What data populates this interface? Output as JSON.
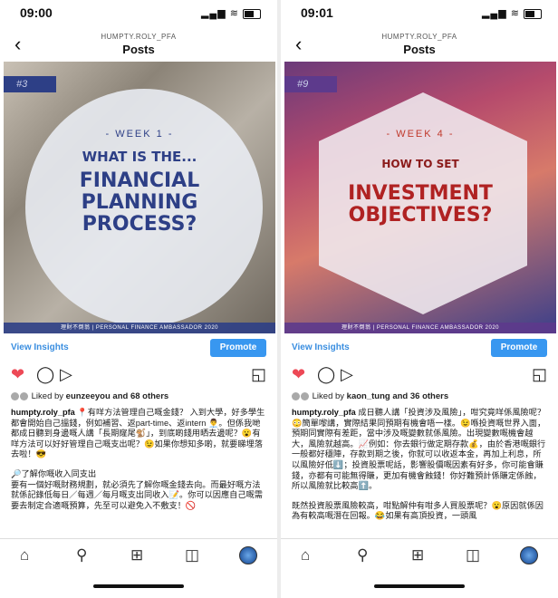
{
  "phones": [
    {
      "time": "09:00",
      "username": "HUMPTY.ROLY_PFA",
      "title": "Posts",
      "post": {
        "tag": "#3",
        "week": "- WEEK 1 -",
        "line1": "WHAT IS THE...",
        "line2": "FINANCIAL",
        "line3": "PLANNING",
        "line4": "PROCESS?",
        "footer": "理財不倒翁 | PERSONAL FINANCE AMBASSADOR 2020"
      },
      "view_insights": "View Insights",
      "promote": "Promote",
      "liked_prefix": "Liked by",
      "liked_user": "eunzeeyou",
      "liked_suffix": "and 68 others",
      "caption_user": "humpty.roly_pfa",
      "caption_text": "📍有咩方法管理自己嘅金錢？ 入到大學，好多學生都會開始自己搵錢，例如補習、返part-time、返intern 👨‍💼。但係我哋都成日聽到身邊嘅人講「長期窿尾🐒」，到底啲錢用晒去邊呢？😮有咩方法可以好好管理自己嘅支出呢？😉如果你想知多啲，就要睇埋落去啦！😎",
      "caption_text2": "🔎了解你嘅收入同支出",
      "caption_text3": "要有一個好嘅財務規劃，就必須先了解你嘅金錢去向。而最好嘅方法就係記錄低每日／每週／每月嘅支出同收入📝。你可以因應自己嘅需要去制定合適嘅預算，先至可以避免入不敷支！🚫",
      "status_icons": "▂▄▆ ≋"
    },
    {
      "time": "09:01",
      "username": "HUMPTY.ROLY_PFA",
      "title": "Posts",
      "post": {
        "tag": "#9",
        "week": "- WEEK 4 -",
        "line1": "HOW TO SET",
        "line2": "INVESTMENT",
        "line3": "OBJECTIVES?",
        "line4": "",
        "footer": "理財不倒翁 | PERSONAL FINANCE AMBASSADOR 2020"
      },
      "view_insights": "View Insights",
      "promote": "Promote",
      "liked_prefix": "Liked by",
      "liked_user": "kaon_tung",
      "liked_suffix": "and 36 others",
      "caption_user": "humpty.roly_pfa",
      "caption_text": "成日聽人講「投資涉及風險」，咁究竟咩係風險呢？😳簡單嚟講，實際結果同預期有機會唔一樣。😉喺投資嘅世界入面，預期同實際有差距，當中涉及嘅變數就係風險。出現變數嘅機會越大，風險就越高。📈例如：你去銀行做定期存款💰，由於香港嘅銀行一般都好穩陣，存款到期之後，你就可以收返本金，再加上利息，所以風險好低⬇️；投資股票呢話，影響股價嘅因素有好多，你可能會賺錢，亦都有可能無得賺，更加有機會蝕錢！你好難預計係賺定係蝕，所以風險就比較高⬆️。",
      "caption_text2": "既然投資股票風險較高，咁點解仲有咁多人買股票呢？😮原因就係因為有較高嘅潛在回報。😂如果有高頂投資，一頭風",
      "caption_text3": "",
      "status_icons": "▂▄▆ ≋"
    }
  ],
  "colors": {
    "accent_blue": "#3897f0",
    "heart_red": "#ed4956",
    "post1_navy": "#2d3f86",
    "post2_red": "#b02222"
  },
  "icons": [
    "back-chevron-icon",
    "heart-icon",
    "comment-icon",
    "share-icon",
    "bookmark-icon",
    "home-icon",
    "search-icon",
    "add-post-icon",
    "shop-bag-icon",
    "profile-avatar-icon"
  ]
}
